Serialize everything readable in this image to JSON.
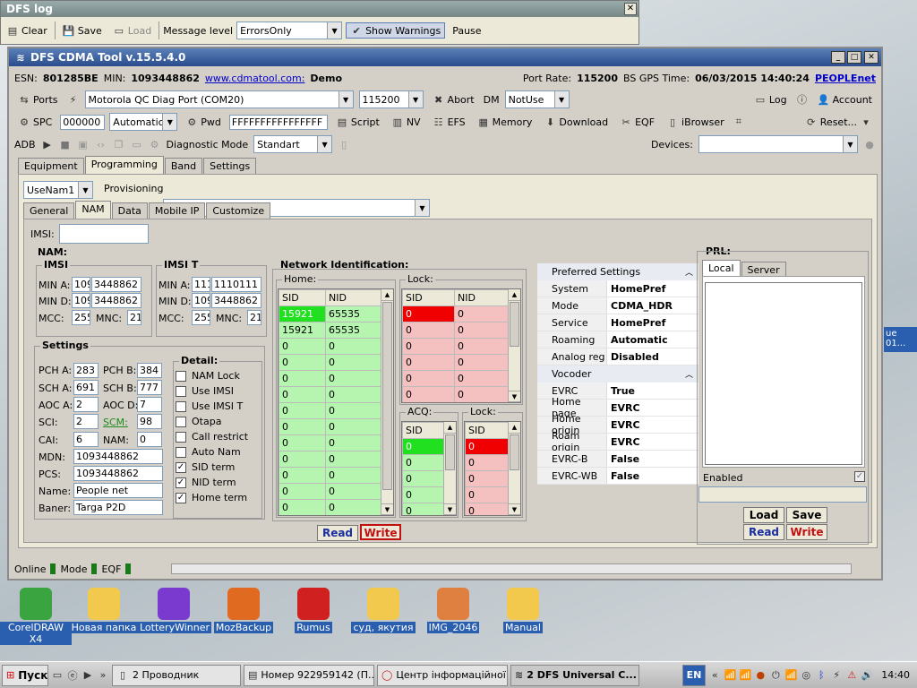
{
  "log_window": {
    "title": "DFS log",
    "clear": "Clear",
    "save": "Save",
    "load": "Load",
    "level_label": "Message level",
    "level_value": "ErrorsOnly",
    "show_warnings": "Show Warnings",
    "pause": "Pause"
  },
  "main": {
    "title": "DFS CDMA Tool v.15.5.4.0",
    "esn_label": "ESN:",
    "esn": "801285BE",
    "min_label": "MIN:",
    "min": "1093448862",
    "site": "www.cdmatool.com:",
    "demo": "Demo",
    "port_rate_label": "Port Rate:",
    "port_rate": "115200",
    "gps_label": "BS GPS Time:",
    "gps": "06/03/2015 14:40:24",
    "carrier": "PEOPLEnet"
  },
  "toolbar1": {
    "ports": "Ports",
    "port": "Motorola QC Diag Port (COM20)",
    "baud": "115200",
    "abort": "Abort",
    "dm": "DM",
    "dm_value": "NotUse",
    "log": "Log",
    "account": "Account"
  },
  "toolbar2": {
    "spc": "SPC",
    "spc_value": "000000",
    "mode": "Automatic",
    "pwd": "Pwd",
    "pwd_value": "FFFFFFFFFFFFFFFF",
    "script": "Script",
    "nv": "NV",
    "efs": "EFS",
    "memory": "Memory",
    "download": "Download",
    "eqf": "EQF",
    "ibrowser": "iBrowser",
    "reset": "Reset..."
  },
  "toolbar3": {
    "adb": "ADB",
    "diag_label": "Diagnostic Mode",
    "diag_value": "Standart",
    "devices": "Devices:"
  },
  "tabs": [
    "Equipment",
    "Programming",
    "Band",
    "Settings"
  ],
  "nam_select": "UseNam1",
  "provisioning": "Provisioning",
  "subtabs": [
    "General",
    "NAM",
    "Data",
    "Mobile IP",
    "Customize"
  ],
  "imsi_label": "IMSI:",
  "nam": {
    "title": "NAM:",
    "imsi": {
      "title": "IMSI",
      "min_a": "MIN A:",
      "min_a_1": "109",
      "min_a_2": "3448862",
      "min_d": "MIN D:",
      "min_d_1": "109",
      "min_d_2": "3448862",
      "mcc": "MCC:",
      "mcc_v": "255",
      "mnc": "MNC:",
      "mnc_v": "21"
    },
    "imsi_t": {
      "title": "IMSI T",
      "min_a": "MIN A:",
      "min_a_1": "111",
      "min_a_2": "1110111",
      "min_d": "MIN D:",
      "min_d_1": "109",
      "min_d_2": "3448862",
      "mcc": "MCC:",
      "mcc_v": "255",
      "mnc": "MNC:",
      "mnc_v": "21"
    },
    "settings": {
      "title": "Settings",
      "pch_a": "PCH A:",
      "pch_a_v": "283",
      "pch_b": "PCH B:",
      "pch_b_v": "384",
      "sch_a": "SCH A:",
      "sch_a_v": "691",
      "sch_b": "SCH B:",
      "sch_b_v": "777",
      "aoc_a": "AOC A:",
      "aoc_a_v": "2",
      "aoc_d": "AOC D:",
      "aoc_d_v": "7",
      "sci": "SCI:",
      "sci_v": "2",
      "scm": "SCM:",
      "scm_v": "98",
      "cai": "CAI:",
      "cai_v": "6",
      "nam": "NAM:",
      "nam_v": "0",
      "mdn": "MDN:",
      "mdn_v": "1093448862",
      "pcs": "PCS:",
      "pcs_v": "1093448862",
      "name": "Name:",
      "name_v": "People net",
      "baner": "Baner:",
      "baner_v": "Targa P2D"
    },
    "detail": {
      "title": "Detail:",
      "items": [
        {
          "label": "NAM Lock",
          "checked": false
        },
        {
          "label": "Use IMSI",
          "checked": false
        },
        {
          "label": "Use IMSI T",
          "checked": false
        },
        {
          "label": "Otapa",
          "checked": false
        },
        {
          "label": "Call restrict",
          "checked": false
        },
        {
          "label": "Auto Nam",
          "checked": false
        },
        {
          "label": "SID term",
          "checked": true
        },
        {
          "label": "NID term",
          "checked": true
        },
        {
          "label": "Home term",
          "checked": true
        }
      ]
    }
  },
  "netid": {
    "title": "Network Identification:",
    "home": "Home:",
    "lock": "Lock:",
    "acq": "ACQ:",
    "lock2": "Lock:",
    "sid": "SID",
    "nid": "NID",
    "home_rows": [
      [
        "15921",
        "65535"
      ],
      [
        "15921",
        "65535"
      ],
      [
        "0",
        "0"
      ],
      [
        "0",
        "0"
      ],
      [
        "0",
        "0"
      ],
      [
        "0",
        "0"
      ],
      [
        "0",
        "0"
      ],
      [
        "0",
        "0"
      ],
      [
        "0",
        "0"
      ],
      [
        "0",
        "0"
      ],
      [
        "0",
        "0"
      ],
      [
        "0",
        "0"
      ],
      [
        "0",
        "0"
      ]
    ],
    "lock_rows": [
      [
        "0",
        "0"
      ],
      [
        "0",
        "0"
      ],
      [
        "0",
        "0"
      ],
      [
        "0",
        "0"
      ],
      [
        "0",
        "0"
      ],
      [
        "0",
        "0"
      ]
    ],
    "acq_rows": [
      "0",
      "0",
      "0",
      "0",
      "0"
    ],
    "lock2_rows": [
      "0",
      "0",
      "0",
      "0",
      "0"
    ],
    "read": "Read",
    "write": "Write"
  },
  "props": {
    "cat1": "Preferred Settings",
    "rows1": [
      [
        "System",
        "HomePref"
      ],
      [
        "Mode",
        "CDMA_HDR"
      ],
      [
        "Service",
        "HomePref"
      ],
      [
        "Roaming",
        "Automatic"
      ],
      [
        "Analog reg",
        "Disabled"
      ]
    ],
    "cat2": "Vocoder",
    "rows2": [
      [
        "EVRC",
        "True"
      ],
      [
        "Home page",
        "EVRC"
      ],
      [
        "Home origin",
        "EVRC"
      ],
      [
        "Roam origin",
        "EVRC"
      ],
      [
        "EVRC-B",
        "False"
      ],
      [
        "EVRC-WB",
        "False"
      ]
    ]
  },
  "prl": {
    "title": "PRL:",
    "tab_local": "Local",
    "tab_server": "Server",
    "enabled": "Enabled",
    "load": "Load",
    "save": "Save",
    "read": "Read",
    "write": "Write"
  },
  "status": {
    "online": "Online",
    "mode": "Mode",
    "eqf": "EQF"
  },
  "partial_window_text": [
    "ue",
    "01..."
  ],
  "desktop_icons": [
    {
      "label": "CorelDRAW X4",
      "color": "#3aa540"
    },
    {
      "label": "Новая папка",
      "color": "#f2c94c"
    },
    {
      "label": "LotteryWinner",
      "color": "#7a3ad0"
    },
    {
      "label": "MozBackup",
      "color": "#e06a20"
    },
    {
      "label": "Rumus",
      "color": "#d02020"
    },
    {
      "label": "суд, якутия",
      "color": "#f2c94c"
    },
    {
      "label": "IMG_2046",
      "color": "#e08040"
    },
    {
      "label": "Manual",
      "color": "#f2c94c"
    }
  ],
  "taskbar": {
    "start": "Пуск",
    "task1": "2 Проводник",
    "task2": "Номер 922959142 (П...",
    "task3": "Центр інформаційної ...",
    "task4": "2 DFS Universal C...",
    "lang": "EN",
    "clock": "14:40"
  }
}
